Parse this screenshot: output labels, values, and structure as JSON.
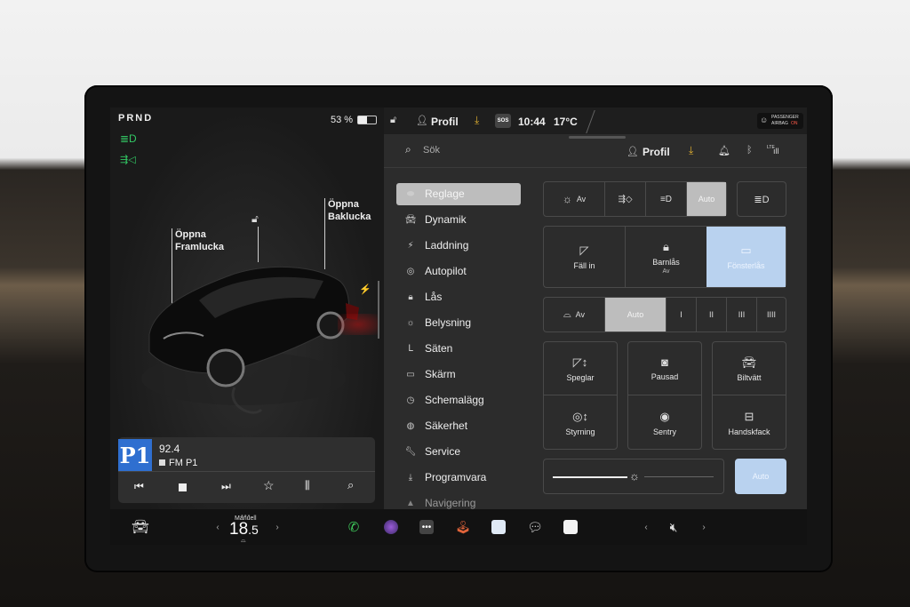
{
  "left": {
    "gear": "PRND",
    "battery": "53 %",
    "frunk_label_1": "Öppna",
    "frunk_label_2": "Framlucka",
    "trunk_label_1": "Öppna",
    "trunk_label_2": "Baklucka",
    "media": {
      "logo": "P1",
      "frequency": "92.4",
      "station": "FM P1"
    }
  },
  "topbar": {
    "profile": "Profil",
    "sos": "SOS",
    "time": "10:44",
    "temperature": "17°C",
    "airbag_1": "PASSENGER",
    "airbag_2": "AIRBAG",
    "airbag_state": "ON"
  },
  "settings_header": {
    "search_placeholder": "Sök",
    "profile": "Profil",
    "lte": "LTE"
  },
  "menu": [
    {
      "label": "Reglage",
      "icon": "toggle-icon"
    },
    {
      "label": "Dynamik",
      "icon": "car-icon"
    },
    {
      "label": "Laddning",
      "icon": "bolt-icon"
    },
    {
      "label": "Autopilot",
      "icon": "steering-icon"
    },
    {
      "label": "Lås",
      "icon": "lock-icon"
    },
    {
      "label": "Belysning",
      "icon": "sun-icon"
    },
    {
      "label": "Säten",
      "icon": "seat-icon"
    },
    {
      "label": "Skärm",
      "icon": "display-icon"
    },
    {
      "label": "Schemalägg",
      "icon": "clock-icon"
    },
    {
      "label": "Säkerhet",
      "icon": "shield-icon"
    },
    {
      "label": "Service",
      "icon": "wrench-icon"
    },
    {
      "label": "Programvara",
      "icon": "download-icon"
    },
    {
      "label": "Navigering",
      "icon": "nav-icon"
    }
  ],
  "lights": {
    "off": "Av",
    "auto": "Auto"
  },
  "mirrors_row": {
    "fold": "Fäll in",
    "childlock": "Barnlås",
    "childlock_state": "Av",
    "windowlock": "Fönsterlås"
  },
  "wipers": {
    "off": "Av",
    "auto": "Auto",
    "speeds": [
      "I",
      "II",
      "III",
      "IIII"
    ]
  },
  "grid": [
    {
      "label": "Speglar",
      "icon": "mirror-adjust-icon"
    },
    {
      "label": "Pausad",
      "icon": "dashcam-icon"
    },
    {
      "label": "Biltvätt",
      "icon": "carwash-icon"
    },
    {
      "label": "Styrning",
      "icon": "steering-adjust-icon"
    },
    {
      "label": "Sentry",
      "icon": "sentry-icon"
    },
    {
      "label": "Handskfack",
      "icon": "glovebox-icon"
    }
  ],
  "brightness": {
    "auto": "Auto"
  },
  "taskbar": {
    "climate_mode": "Manuell",
    "temp_main": "18",
    "temp_decimal": ".5"
  },
  "colors": {
    "accent_blue": "#b9d2ef",
    "selected_gray": "#bdbdbd",
    "green_indicator": "#32c864",
    "download_yellow": "#e0b030"
  }
}
